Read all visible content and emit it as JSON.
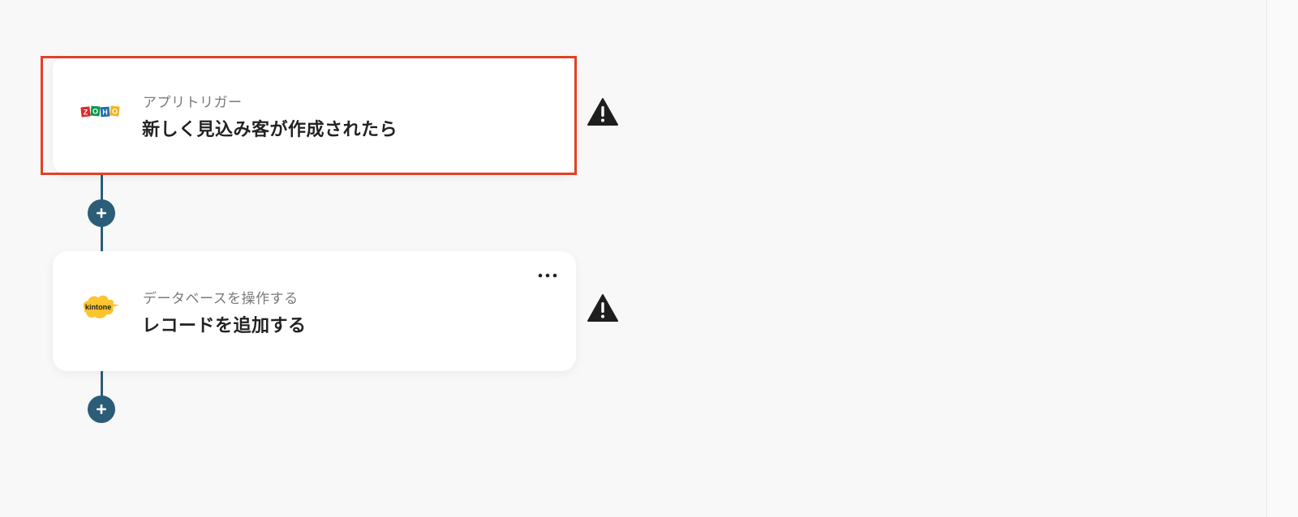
{
  "flow": {
    "steps": [
      {
        "subtitle": "アプリトリガー",
        "title": "新しく見込み客が作成されたら",
        "app": "Zoho",
        "logo_letters": [
          "Z",
          "O",
          "H",
          "O"
        ],
        "logo_colors": [
          "#e42527",
          "#089949",
          "#226db4",
          "#f9b21d"
        ],
        "selected": true,
        "warning": true
      },
      {
        "subtitle": "データベースを操作する",
        "title": "レコードを追加する",
        "app": "kintone",
        "logo_text": "kintone",
        "logo_color": "#fcc42d",
        "selected": false,
        "warning": true
      }
    ]
  },
  "icons": {
    "add": "plus-icon",
    "warning": "warning-triangle-icon",
    "more": "more-horizontal-icon"
  },
  "colors": {
    "background": "#f8f8f8",
    "connector": "#2b5d78",
    "highlight": "#e24026",
    "warning": "#1e1e1e"
  }
}
